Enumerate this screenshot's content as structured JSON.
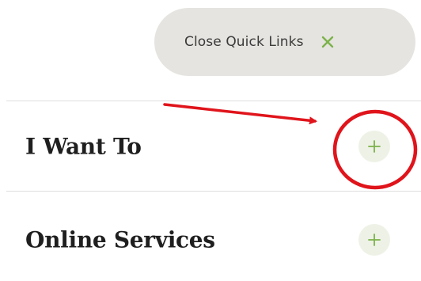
{
  "quick_links": {
    "close_label": "Close Quick Links",
    "close_icon": "close-x-icon",
    "accent_color": "#7bb24a"
  },
  "sections": [
    {
      "label": "I Want To",
      "icon": "plus-icon"
    },
    {
      "label": "Online Services",
      "icon": "plus-icon"
    }
  ],
  "annotation": {
    "color": "#e0141b",
    "arrow": "arrow-pointing-to-plus",
    "highlight": "red-circle-around-plus"
  }
}
